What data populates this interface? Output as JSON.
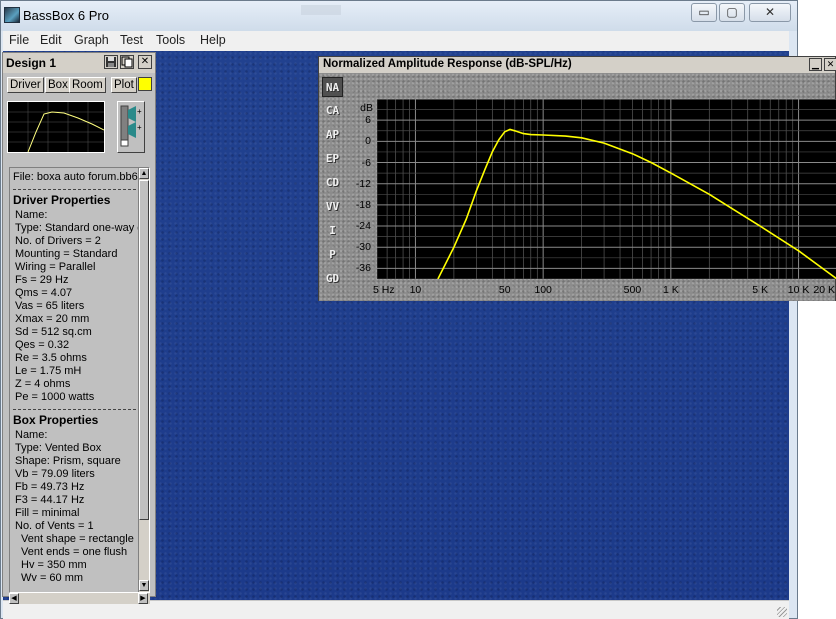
{
  "window": {
    "title": "BassBox 6 Pro",
    "min_glyph": "▭",
    "max_glyph": "▢",
    "close_glyph": "✕"
  },
  "menu": [
    "File",
    "Edit",
    "Graph",
    "Test",
    "Tools",
    "Help"
  ],
  "design_panel": {
    "title": "Design 1",
    "tabs": [
      "Driver",
      "Box",
      "Room",
      "Plot"
    ],
    "swatch_color": "#ffff00",
    "close_glyph": "✕",
    "file_line": "File: boxa auto forum.bb6",
    "driver_heading": "Driver Properties",
    "driver_lines": [
      "Name:",
      "Type: Standard one-way dr",
      "No. of Drivers = 2",
      "Mounting = Standard",
      "Wiring = Parallel",
      "Fs =  29 Hz",
      "Qms =  4.07",
      "Vas =  65 liters",
      "Xmax =  20 mm",
      "Sd =  512 sq.cm",
      "Qes =  0.32",
      "Re =  3.5 ohms",
      "Le =  1.75 mH",
      "Z =  4 ohms",
      "Pe =  1000 watts"
    ],
    "box_heading": "Box Properties",
    "box_lines": [
      "Name:",
      "Type: Vented Box",
      "Shape: Prism, square",
      "Vb =  79.09 liters",
      "Fb =  49.73 Hz",
      "F3 =  44.17 Hz",
      "Fill = minimal",
      "No. of Vents = 1"
    ],
    "vent_lines": [
      "Vent shape = rectangle",
      "Vent ends = one flush",
      "Hv =  350 mm",
      "Wv =  60 mm"
    ]
  },
  "graph_window": {
    "title": "Normalized Amplitude Response (dB-SPL/Hz)",
    "side_tabs": [
      "NA",
      "CA",
      "AP",
      "EP",
      "CD",
      "VV",
      "I",
      "P",
      "GD"
    ],
    "active_tab": "NA",
    "unit_label": "dB",
    "y_ticks": [
      "6",
      "0",
      "-6",
      "-12",
      "-18",
      "-24",
      "-30",
      "-36"
    ],
    "x_ticks": [
      "5 Hz",
      "10",
      "50",
      "100",
      "500",
      "1 K",
      "5 K",
      "10 K",
      "20 K"
    ],
    "curve_color": "#ffff00"
  },
  "chart_data": {
    "type": "line",
    "title": "Normalized Amplitude Response (dB-SPL/Hz)",
    "xlabel": "",
    "ylabel": "dB",
    "x_scale": "log",
    "xlim": [
      5,
      20000
    ],
    "ylim": [
      -39,
      12
    ],
    "grid": true,
    "x": [
      15,
      20,
      25,
      30,
      35,
      40,
      45,
      50,
      55,
      60,
      70,
      80,
      100,
      150,
      200,
      300,
      500,
      700,
      1000,
      2000,
      3000,
      5000,
      10000,
      20000
    ],
    "series": [
      {
        "values": [
          -39,
          -30,
          -22,
          -14,
          -8,
          -3,
          0.5,
          2.7,
          3.4,
          3.0,
          2.2,
          1.9,
          1.8,
          1.5,
          1.0,
          -0.5,
          -3.5,
          -6,
          -9,
          -15,
          -19,
          -24,
          -31,
          -39
        ]
      }
    ]
  }
}
